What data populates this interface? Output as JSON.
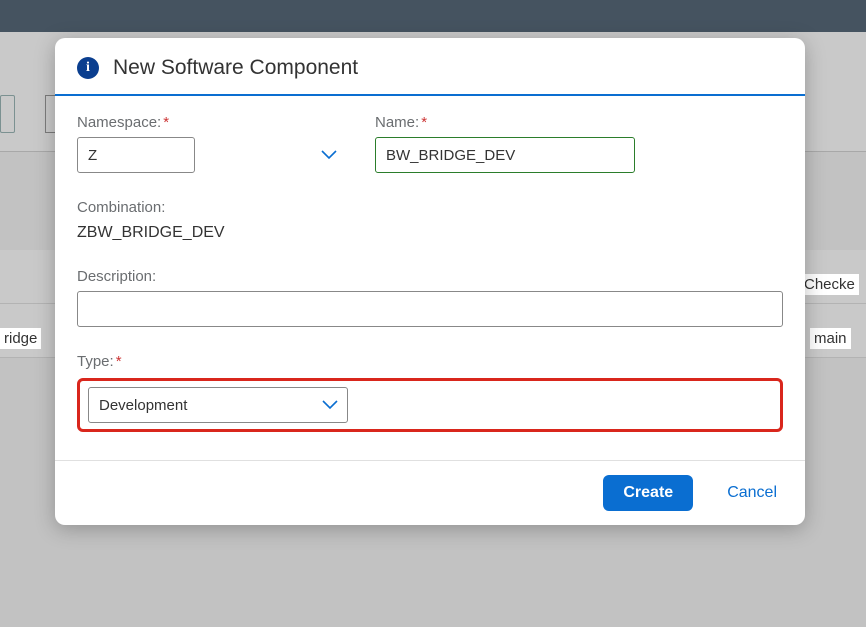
{
  "background": {
    "colHeader": "Checke",
    "cell1": "ridge",
    "cell2": "main"
  },
  "modal": {
    "title": "New Software Component",
    "namespace": {
      "label": "Namespace:",
      "value": "Z"
    },
    "name": {
      "label": "Name:",
      "value": "BW_BRIDGE_DEV"
    },
    "combination": {
      "label": "Combination:",
      "value": "ZBW_BRIDGE_DEV"
    },
    "description": {
      "label": "Description:",
      "value": ""
    },
    "type": {
      "label": "Type:",
      "value": "Development"
    },
    "required_marker": "*",
    "buttons": {
      "create": "Create",
      "cancel": "Cancel"
    }
  }
}
